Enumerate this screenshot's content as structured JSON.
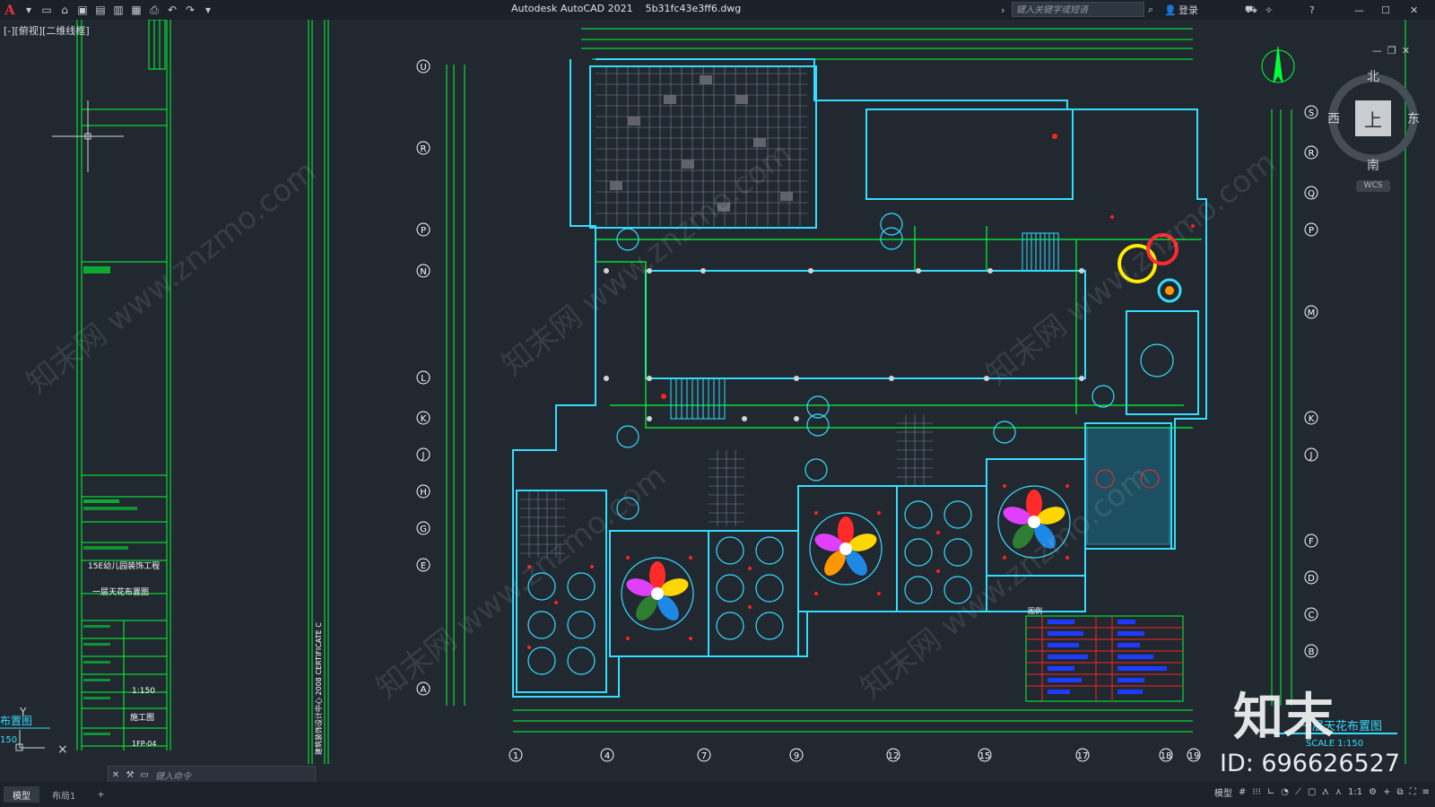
{
  "app": {
    "title": "Autodesk AutoCAD 2021    5b31fc43e3ff6.dwg",
    "logo": "A",
    "search_placeholder": "键入关键字或短语",
    "login": "登录",
    "quick_access": [
      "new-icon",
      "open-icon",
      "save-icon",
      "saveas-icon",
      "plot-preview-icon",
      "publish-icon",
      "print-icon",
      "undo-icon",
      "redo-icon",
      "customize-icon"
    ]
  },
  "viewport": {
    "label": "[-][俯视][二维线框]",
    "viewcube": {
      "north": "北",
      "south": "南",
      "east": "东",
      "west": "西",
      "face": "上",
      "wcs": "WCS"
    }
  },
  "titleblock": {
    "project_name": "15E幼儿园装饰工程",
    "drawing_name": "一层天花布置图",
    "scale": "1:150",
    "stage": "施工图",
    "number": "1FP-04",
    "vertical_text": "建筑装饰设计中心  2008  CERTIFICATE C"
  },
  "drawing": {
    "left_fragment_title": "布置图",
    "left_fragment_scale": "150",
    "right_title": "一层天花布置图",
    "right_scale": "SCALE  1:150",
    "legend_title": "图例",
    "row_axes": [
      "U",
      "R",
      "P",
      "N",
      "L",
      "K",
      "J",
      "H",
      "G",
      "E",
      "A"
    ],
    "right_axes": [
      "S",
      "R",
      "Q",
      "P",
      "M",
      "K",
      "J",
      "F",
      "D",
      "C",
      "B"
    ],
    "col_axes": [
      "1",
      "4",
      "7",
      "9",
      "12",
      "15",
      "17",
      "18",
      "19"
    ]
  },
  "command": {
    "placeholder": "键入命令"
  },
  "status": {
    "tabs": [
      {
        "label": "模型",
        "active": true
      },
      {
        "label": "布局1",
        "active": false
      }
    ],
    "add_tab": "+",
    "model_label": "模型",
    "scale": "1:1"
  },
  "watermark": {
    "text": "知末网 www.znzmo.com",
    "logo": "知末",
    "id": "ID: 696626527"
  },
  "colors": {
    "background": "#212830",
    "lines": "#00ff33",
    "walls": "#33ddff",
    "accent": "#ff2222"
  }
}
